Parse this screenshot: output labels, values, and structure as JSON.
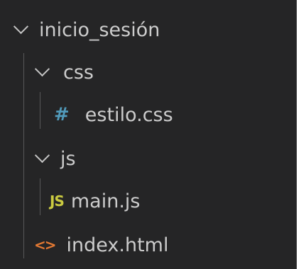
{
  "explorer": {
    "root": {
      "label": "inicio_sesión",
      "expanded": true
    },
    "css_folder": {
      "label": "css",
      "expanded": true
    },
    "css_file": {
      "label": "estilo.css",
      "icon": "#"
    },
    "js_folder": {
      "label": "js",
      "expanded": true
    },
    "js_file": {
      "label": "main.js",
      "icon": "JS"
    },
    "html_file": {
      "label": "index.html",
      "icon": "<>"
    }
  },
  "colors": {
    "background": "#252526",
    "text": "#cccccc",
    "css_icon": "#519aba",
    "js_icon": "#cbcb41",
    "html_icon": "#e37933",
    "indent_guide": "#585858"
  }
}
